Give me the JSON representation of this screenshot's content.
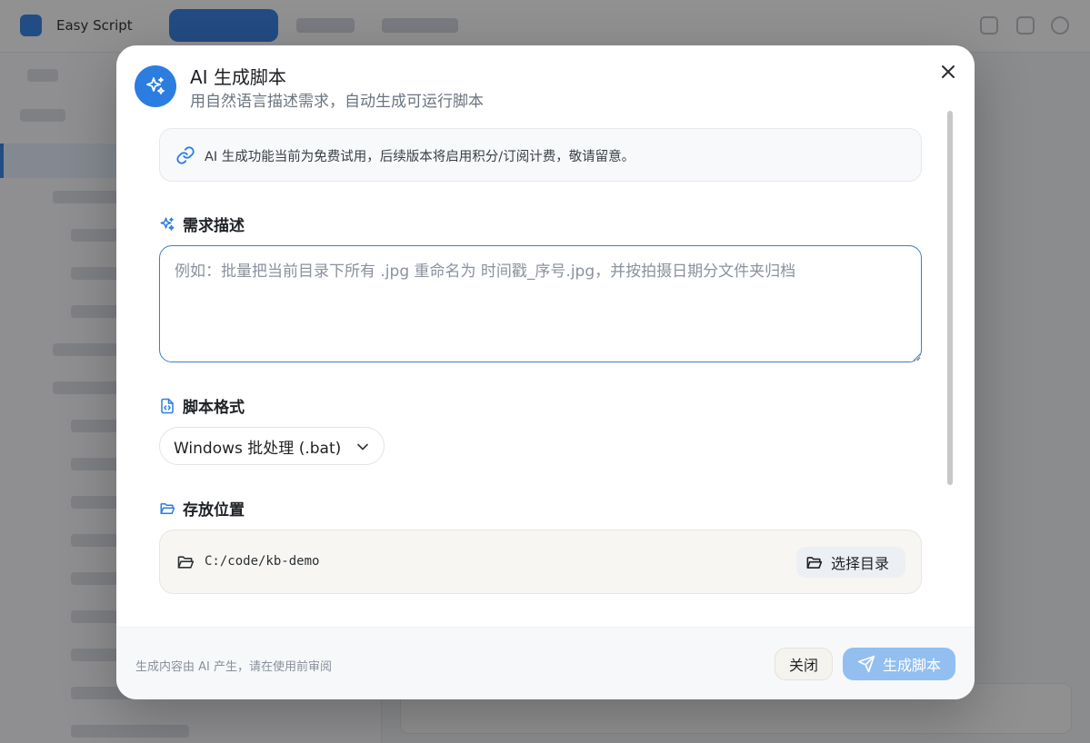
{
  "background_app": {
    "name": "Easy Script"
  },
  "dialog": {
    "title": "AI 生成脚本",
    "subtitle": "用自然语言描述需求，自动生成可运行脚本",
    "header_icon": "sparkles-icon",
    "close_icon": "close-icon",
    "notice": {
      "icon": "link-icon",
      "text": "AI 生成功能当前为免费试用，后续版本将启用积分/订阅计费，敬请留意。"
    },
    "requirement": {
      "label": "需求描述",
      "icon": "sparkles-icon",
      "placeholder": "例如：批量把当前目录下所有 .jpg 重命名为 时间戳_序号.jpg，并按拍摄日期分文件夹归档",
      "value": ""
    },
    "format": {
      "label": "脚本格式",
      "icon": "code-file-icon",
      "selected": "Windows 批处理 (.bat)"
    },
    "location": {
      "label": "存放位置",
      "icon": "folder-open-icon",
      "path": "C:/code/kb-demo",
      "choose_button": "选择目录"
    },
    "footer": {
      "note": "生成内容由 AI 产生，请在使用前审阅",
      "close_button": "关闭",
      "generate_button": "生成脚本"
    }
  },
  "colors": {
    "accent": "#2b7de0",
    "generate_button_disabled": "#92bff0",
    "textarea_focus_border": "#3d7fc7"
  }
}
